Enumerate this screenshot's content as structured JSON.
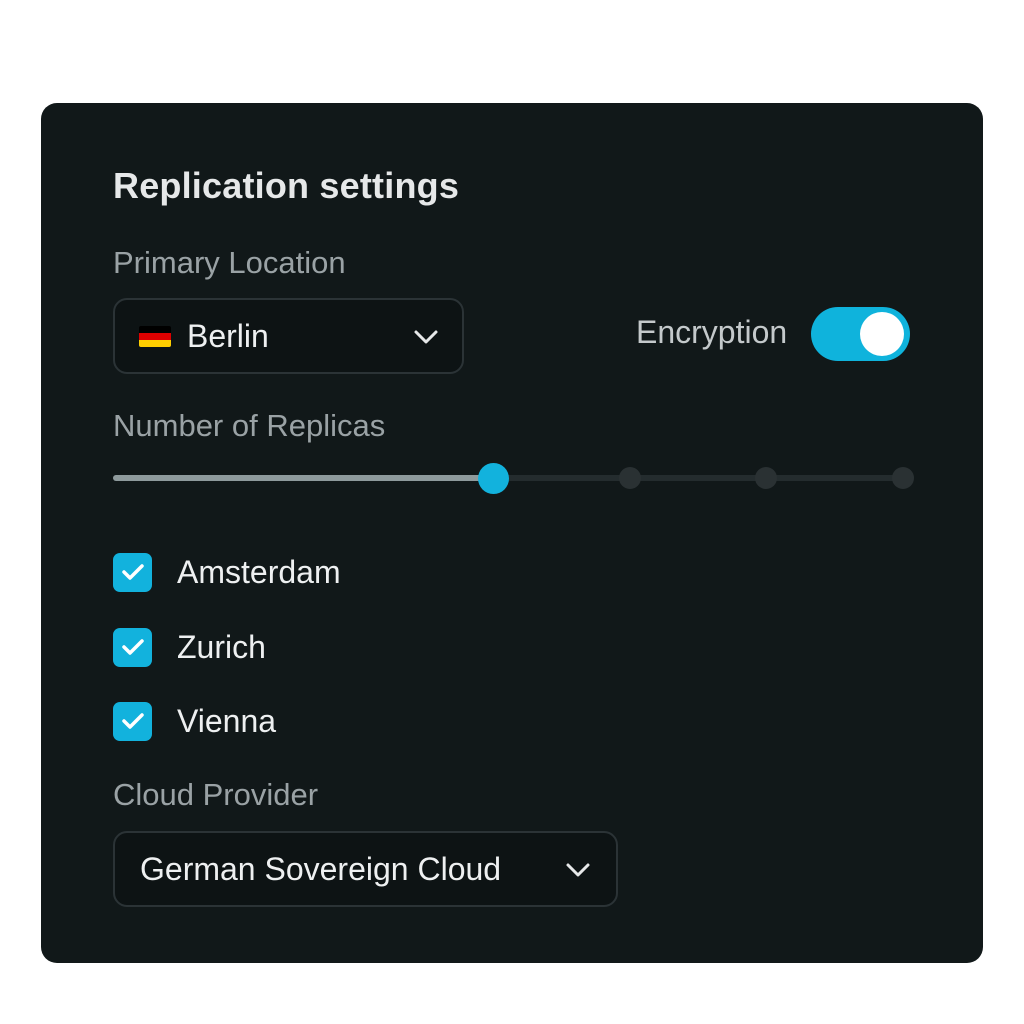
{
  "panel": {
    "title": "Replication settings"
  },
  "primary_location": {
    "label": "Primary Location",
    "selected": "Berlin",
    "flag_icon": "germany-flag-icon",
    "flag_colors": [
      "#000000",
      "#dd0000",
      "#ffce00"
    ]
  },
  "encryption": {
    "label": "Encryption",
    "enabled": true
  },
  "replicas": {
    "label": "Number of Replicas",
    "stops": 5,
    "selected_index": 1
  },
  "regions": [
    {
      "label": "Amsterdam",
      "checked": true
    },
    {
      "label": "Zurich",
      "checked": true
    },
    {
      "label": "Vienna",
      "checked": true
    }
  ],
  "cloud_provider": {
    "label": "Cloud Provider",
    "selected": "German Sovereign Cloud"
  },
  "colors": {
    "accent": "#12b2dd",
    "panel_background": "#111819"
  }
}
